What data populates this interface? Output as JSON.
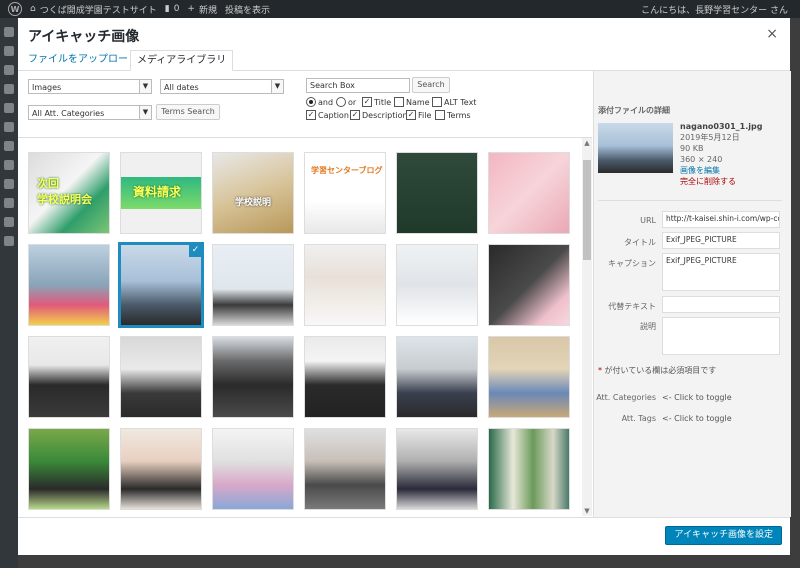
{
  "admin_bar": {
    "site_name": "つくば開成学園テストサイト",
    "comments_count": "0",
    "new_label": "新規",
    "view_post_label": "投稿を表示",
    "greeting": "こんにちは、長野学習センター さん"
  },
  "modal": {
    "title": "アイキャッチ画像",
    "close_symbol": "×"
  },
  "tabs": [
    {
      "label": "ファイルをアップロード"
    },
    {
      "label": "メディアライブラリ"
    }
  ],
  "filters": {
    "type_select": "Images",
    "date_select": "All dates",
    "category_select": "All Att. Categories",
    "terms_search_button": "Terms Search",
    "search_placeholder": "Search Box",
    "search_button": "Search",
    "and_label": "and",
    "or_label": "or",
    "options": {
      "title": "Title",
      "name": "Name",
      "alt_text": "ALT Text",
      "caption": "Caption",
      "description": "Description",
      "file": "File",
      "terms": "Terms"
    }
  },
  "grid": {
    "captions": {
      "t1": "次回\n学校説明会",
      "t2": "資料請求",
      "t3": "学校説明",
      "t4": "学習センターブログ"
    }
  },
  "details": {
    "heading": "添付ファイルの詳細",
    "filename": "nagano0301_1.jpg",
    "date": "2019年5月12日",
    "filesize": "90 KB",
    "dimensions": "360 × 240",
    "edit_image": "画像を編集",
    "delete_permanently": "完全に削除する",
    "url_label": "URL",
    "url_value": "http://t-kaisei.shin-i.com/wp-cor",
    "title_label": "タイトル",
    "title_value": "Exif_JPEG_PICTURE",
    "caption_label": "キャプション",
    "caption_value": "Exif_JPEG_PICTURE",
    "alt_label": "代替テキスト",
    "alt_value": "",
    "desc_label": "説明",
    "desc_value": "",
    "required_note": "が付いている欄は必須項目です",
    "required_star": "*",
    "att_categories_label": "Att. Categories",
    "att_tags_label": "Att. Tags",
    "toggle_text": "<- Click to toggle"
  },
  "footer": {
    "set_button": "アイキャッチ画像を設定"
  },
  "colors": {
    "accent": "#0073aa",
    "primary_button": "#0085ba",
    "selected_border": "#1e8cbe",
    "admin_bar": "#23282d"
  }
}
